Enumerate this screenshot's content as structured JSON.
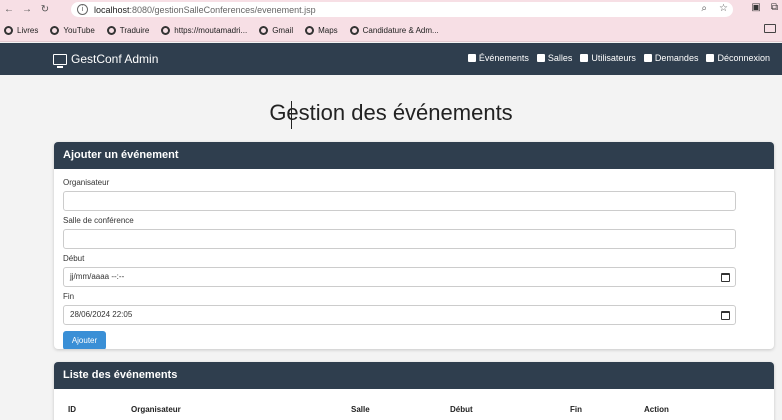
{
  "browser": {
    "url_host": "localhost",
    "url_rest": ":8080/gestionSalleConferences/evenement.jsp",
    "bookmarks": [
      "Livres",
      "YouTube",
      "Traduire",
      "https://moutamadri...",
      "Gmail",
      "Maps",
      "Candidature & Adm..."
    ]
  },
  "navbar": {
    "brand": "GestConf Admin",
    "links": [
      "Événements",
      "Salles",
      "Utilisateurs",
      "Demandes",
      "Déconnexion"
    ]
  },
  "page": {
    "title": "Gestion des événements"
  },
  "form_card": {
    "title": "Ajouter un événement",
    "fields": [
      {
        "label": "Organisateur",
        "value": ""
      },
      {
        "label": "Salle de conférence",
        "value": ""
      },
      {
        "label": "Début",
        "value": "jj/mm/aaaa --:--"
      },
      {
        "label": "Fin",
        "value": "28/06/2024 22:05"
      }
    ],
    "submit_label": "Ajouter"
  },
  "list_card": {
    "title": "Liste des événements",
    "columns": [
      "ID",
      "Organisateur",
      "Salle",
      "Début",
      "Fin",
      "Action"
    ]
  }
}
